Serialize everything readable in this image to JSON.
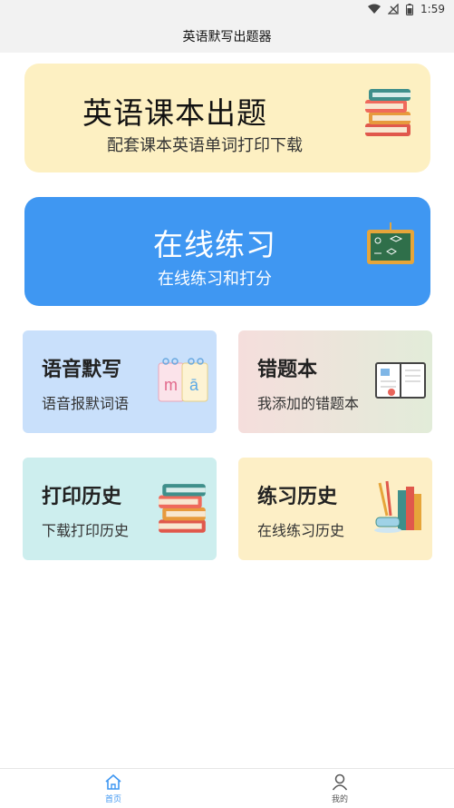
{
  "status_bar": {
    "time": "1:59"
  },
  "app_bar": {
    "title": "英语默写出题器"
  },
  "cards": {
    "textbook": {
      "title": "英语课本出题",
      "subtitle": "配套课本英语单词打印下载"
    },
    "online_practice": {
      "title": "在线练习",
      "subtitle": "在线练习和打分"
    },
    "dictation": {
      "title": "语音默写",
      "subtitle": "语音报默词语"
    },
    "wrong_book": {
      "title": "错题本",
      "subtitle": "我添加的错题本"
    },
    "print_history": {
      "title": "打印历史",
      "subtitle": "下载打印历史"
    },
    "practice_history": {
      "title": "练习历史",
      "subtitle": "在线练习历史"
    }
  },
  "tab_bar": {
    "home": {
      "label": "首页",
      "icon": "home-icon",
      "active": true
    },
    "mine": {
      "label": "我的",
      "icon": "person-icon",
      "active": false
    }
  },
  "colors": {
    "accent": "#3f97f2",
    "yellow_card": "#fdf0c2",
    "blue_card": "#3f97f2"
  }
}
